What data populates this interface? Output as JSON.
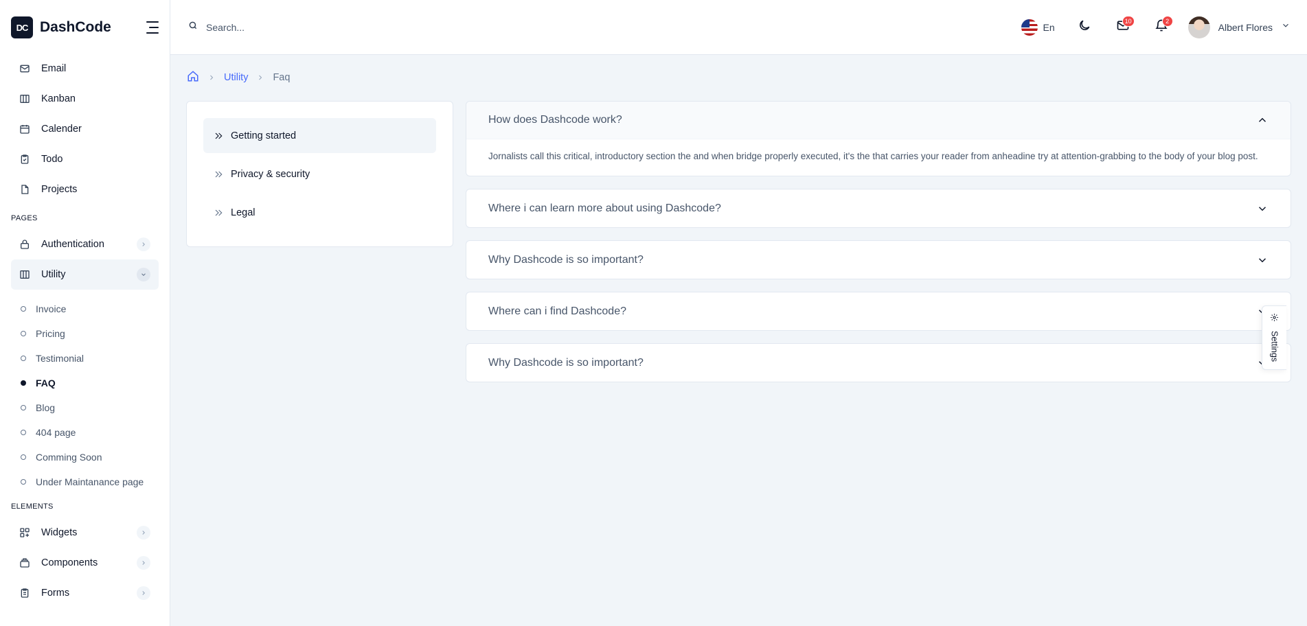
{
  "brand": {
    "name": "DashCode",
    "logo_text": "DC"
  },
  "sidebar": {
    "apps": [
      {
        "label": "Email",
        "icon": "mail-icon"
      },
      {
        "label": "Kanban",
        "icon": "columns-icon"
      },
      {
        "label": "Calender",
        "icon": "calendar-icon"
      },
      {
        "label": "Todo",
        "icon": "clipboard-icon"
      },
      {
        "label": "Projects",
        "icon": "file-icon"
      }
    ],
    "pages_label": "PAGES",
    "authentication_label": "Authentication",
    "utility_label": "Utility",
    "utility_sub": [
      "Invoice",
      "Pricing",
      "Testimonial",
      "FAQ",
      "Blog",
      "404 page",
      "Comming Soon",
      "Under Maintanance page"
    ],
    "active_sub": "FAQ",
    "elements_label": "ELEMENTS",
    "elements": [
      {
        "label": "Widgets",
        "icon": "grid-plus-icon"
      },
      {
        "label": "Components",
        "icon": "package-icon"
      },
      {
        "label": "Forms",
        "icon": "clipboard-list-icon"
      }
    ]
  },
  "header": {
    "search_placeholder": "Search...",
    "language": "En",
    "messages_count": "10",
    "notifications_count": "2",
    "user_name": "Albert Flores"
  },
  "breadcrumb": {
    "section": "Utility",
    "current": "Faq"
  },
  "categories": [
    {
      "label": "Getting started",
      "active": true
    },
    {
      "label": "Privacy & security",
      "active": false
    },
    {
      "label": "Legal",
      "active": false
    }
  ],
  "faqs": [
    {
      "question": "How does Dashcode work?",
      "answer": "Jornalists call this critical, introductory section the and when bridge properly executed, it's the that carries your reader from anheadine try at attention-grabbing to the body of your blog post.",
      "open": true
    },
    {
      "question": "Where i can learn more about using Dashcode?",
      "open": false
    },
    {
      "question": "Why Dashcode is so important?",
      "open": false
    },
    {
      "question": "Where can i find Dashcode?",
      "open": false
    },
    {
      "question": "Why Dashcode is so important?",
      "open": false
    }
  ],
  "settings_label": "Settings",
  "colors": {
    "accent": "#4669fa",
    "badge": "#ef4444",
    "dark": "#0f172a"
  }
}
